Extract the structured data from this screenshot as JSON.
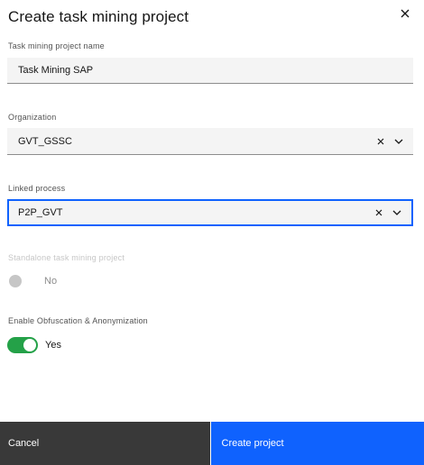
{
  "modal": {
    "title": "Create task mining project"
  },
  "fields": {
    "project_name": {
      "label": "Task mining project name",
      "value": "Task Mining SAP"
    },
    "organization": {
      "label": "Organization",
      "value": "GVT_GSSC"
    },
    "linked_process": {
      "label": "Linked process",
      "value": "P2P_GVT"
    },
    "standalone": {
      "label": "Standalone task mining project",
      "state_text": "No"
    },
    "obfuscation": {
      "label": "Enable Obfuscation & Anonymization",
      "state_text": "Yes"
    }
  },
  "footer": {
    "cancel_label": "Cancel",
    "create_label": "Create project"
  },
  "icons": {
    "close": "close-icon",
    "clear": "clear-icon",
    "chevron": "chevron-down-icon"
  },
  "colors": {
    "primary": "#0f62fe",
    "secondary": "#393939",
    "toggle_on": "#24a148",
    "field_bg": "#f4f4f4"
  }
}
